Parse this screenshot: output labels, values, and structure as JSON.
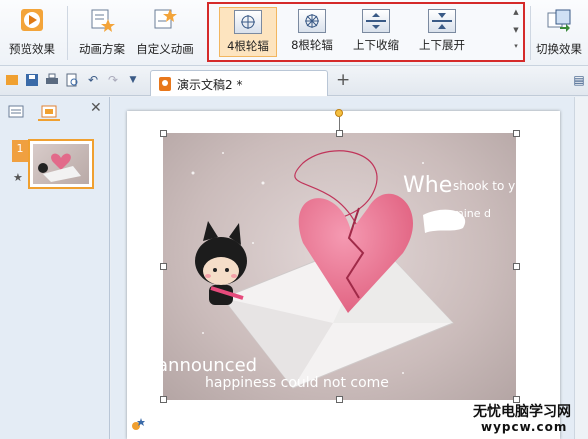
{
  "ribbon": {
    "preview_label": "预览效果",
    "scheme_label": "动画方案",
    "custom_label": "自定义动画",
    "switch_label": "切换效果",
    "gallery": [
      {
        "label": "4根轮辐",
        "selected": true
      },
      {
        "label": "8根轮辐",
        "selected": false
      },
      {
        "label": "上下收缩",
        "selected": false
      },
      {
        "label": "上下展开",
        "selected": false
      }
    ],
    "gallery_border_color": "#d52a2a"
  },
  "tabbar": {
    "doc_title": "演示文稿2 *"
  },
  "leftpanel": {
    "slide_number": "1"
  },
  "slide": {
    "text_whe": "Whe",
    "text_shook": "shook to y",
    "text_mine": "mine d",
    "text_announced": "announced",
    "text_happiness": "happiness could not come"
  },
  "watermark": {
    "line1": "无忧电脑学习网",
    "line2": "wypcw.com"
  }
}
